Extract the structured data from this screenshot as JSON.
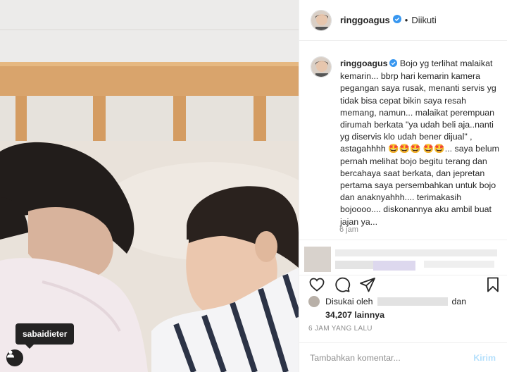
{
  "photo": {
    "tag_label": "sabaidieter"
  },
  "header": {
    "username": "ringgoagus",
    "separator": "•",
    "follow_status": "Diikuti"
  },
  "caption": {
    "username": "ringgoagus",
    "text": " Bojo yg terlihat malaikat kemarin... bbrp hari kemarin kamera pegangan saya rusak, menanti servis yg tidak bisa cepat bikin saya resah memang, namun... malaikat perempuan dirumah berkata \"ya udah beli aja..nanti yg diservis klo udah bener dijual\" , astagahhhh 🤩🤩🤩 🤩🤩... saya belum pernah melihat bojo begitu terang dan bercahaya saat berkata, dan jepretan pertama saya persembahkan untuk bojo dan anaknyahhh.... terimakasih bojoooo.... diskonannya aku ambil buat jajan ya...",
    "time": "6 jam"
  },
  "likes": {
    "prefix": "Disukai oleh",
    "and": "dan",
    "count": "34,207",
    "others": "lainnya"
  },
  "post_time": "6 JAM YANG LALU",
  "comment": {
    "placeholder": "Tambahkan komentar...",
    "post_label": "Kirim"
  },
  "colors": {
    "verified": "#3897f0",
    "post_button": "#b3dffc",
    "muted": "#8e8e8e"
  }
}
